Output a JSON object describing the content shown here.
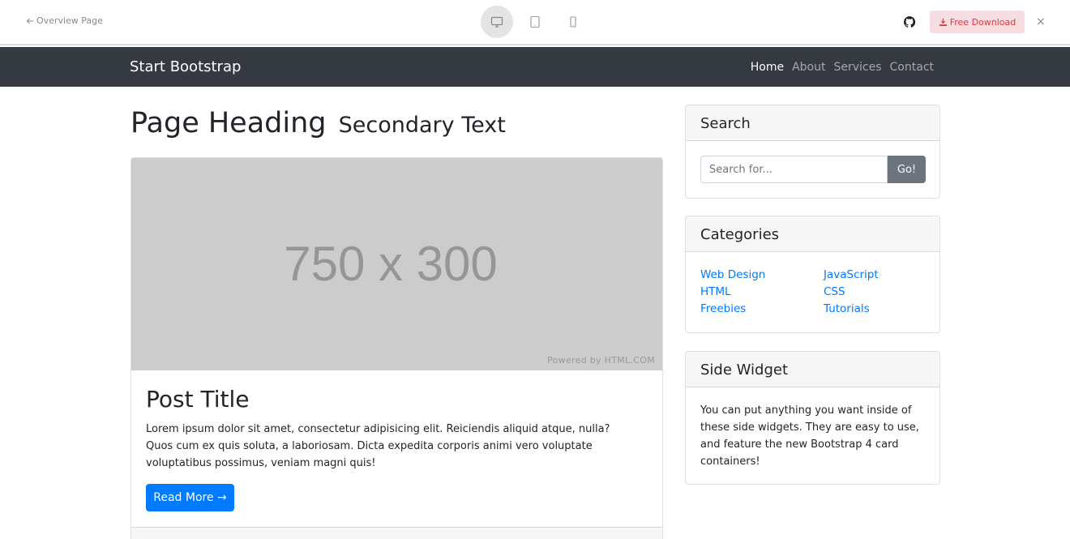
{
  "preview": {
    "back_label": "Overview Page",
    "devices": [
      "desktop-icon",
      "tablet-icon",
      "mobile-icon"
    ],
    "download_label": "Free Download",
    "close_label": "×"
  },
  "navbar": {
    "brand": "Start Bootstrap",
    "links": [
      "Home",
      "About",
      "Services",
      "Contact"
    ]
  },
  "main": {
    "heading": "Page Heading",
    "heading_small": "Secondary Text",
    "post": {
      "image_label": "750 x 300",
      "image_credit": "Powered by HTML.COM",
      "title": "Post Title",
      "text": "Lorem ipsum dolor sit amet, consectetur adipisicing elit. Reiciendis aliquid atque, nulla? Quos cum ex quis soluta, a laboriosam. Dicta expedita corporis animi vero voluptate voluptatibus possimus, veniam magni quis!",
      "button": "Read More →"
    }
  },
  "sidebar": {
    "search": {
      "title": "Search",
      "placeholder": "Search for...",
      "button": "Go!"
    },
    "categories": {
      "title": "Categories",
      "items": [
        "Web Design",
        "JavaScript",
        "HTML",
        "CSS",
        "Freebies",
        "Tutorials"
      ]
    },
    "widget": {
      "title": "Side Widget",
      "text": "You can put anything you want inside of these side widgets. They are easy to use, and feature the new Bootstrap 4 card containers!"
    }
  },
  "colors": {
    "navbar_bg": "#343a40",
    "primary": "#007bff",
    "secondary": "#6c757d",
    "download_bg": "#f8dde0",
    "download_text": "#e8343f"
  }
}
